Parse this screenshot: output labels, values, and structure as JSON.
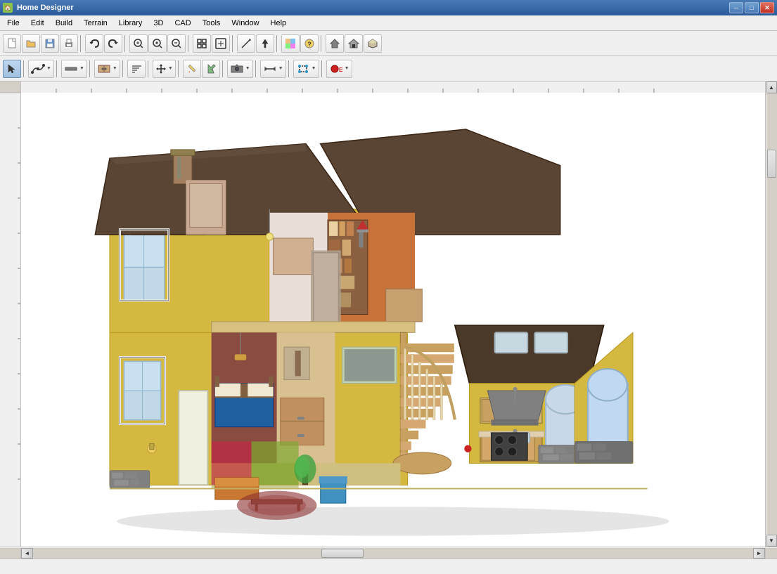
{
  "window": {
    "title": "Home Designer",
    "icon": "🏠"
  },
  "titlebar": {
    "controls": {
      "minimize": "─",
      "maximize": "□",
      "close": "✕"
    }
  },
  "menubar": {
    "items": [
      "File",
      "Edit",
      "Build",
      "Terrain",
      "Library",
      "3D",
      "CAD",
      "Tools",
      "Window",
      "Help"
    ]
  },
  "toolbar1": {
    "buttons": [
      {
        "id": "new",
        "icon": "📄",
        "title": "New"
      },
      {
        "id": "open",
        "icon": "📂",
        "title": "Open"
      },
      {
        "id": "save",
        "icon": "💾",
        "title": "Save"
      },
      {
        "id": "print",
        "icon": "🖨",
        "title": "Print"
      },
      {
        "id": "sep1",
        "type": "sep"
      },
      {
        "id": "undo",
        "icon": "↩",
        "title": "Undo"
      },
      {
        "id": "redo",
        "icon": "↪",
        "title": "Redo"
      },
      {
        "id": "sep2",
        "type": "sep"
      },
      {
        "id": "zoom-in-rect",
        "icon": "🔍",
        "title": "Zoom In"
      },
      {
        "id": "zoom-in",
        "icon": "⊕",
        "title": "Zoom In"
      },
      {
        "id": "zoom-out",
        "icon": "⊖",
        "title": "Zoom Out"
      },
      {
        "id": "sep3",
        "type": "sep"
      },
      {
        "id": "fit",
        "icon": "⊞",
        "title": "Fit"
      },
      {
        "id": "pan",
        "icon": "✋",
        "title": "Pan"
      },
      {
        "id": "sep4",
        "type": "sep"
      },
      {
        "id": "draw-line",
        "icon": "╱",
        "title": "Draw Line"
      },
      {
        "id": "arrow-up",
        "icon": "△",
        "title": "Arrow"
      },
      {
        "id": "sep5",
        "type": "sep"
      },
      {
        "id": "texture",
        "icon": "▣",
        "title": "Texture"
      },
      {
        "id": "help",
        "icon": "?",
        "title": "Help"
      },
      {
        "id": "sep6",
        "type": "sep"
      },
      {
        "id": "house1",
        "icon": "⌂",
        "title": "House"
      },
      {
        "id": "house2",
        "icon": "🏠",
        "title": "House 2"
      },
      {
        "id": "house3",
        "icon": "🏡",
        "title": "House 3"
      }
    ]
  },
  "toolbar2": {
    "buttons": [
      {
        "id": "select",
        "icon": "↖",
        "title": "Select",
        "active": true
      },
      {
        "id": "sep1",
        "type": "sep"
      },
      {
        "id": "polyline",
        "icon": "⌒",
        "title": "Polyline"
      },
      {
        "id": "sep2",
        "type": "sep"
      },
      {
        "id": "wall",
        "icon": "▬",
        "title": "Wall"
      },
      {
        "id": "sep3",
        "type": "sep"
      },
      {
        "id": "cabinet",
        "icon": "▦",
        "title": "Cabinet"
      },
      {
        "id": "sep4",
        "type": "sep"
      },
      {
        "id": "stairs",
        "icon": "⚏",
        "title": "Stairs"
      },
      {
        "id": "sep5",
        "type": "sep"
      },
      {
        "id": "move",
        "icon": "⊹",
        "title": "Move"
      },
      {
        "id": "sep6",
        "type": "sep"
      },
      {
        "id": "paint",
        "icon": "✏",
        "title": "Paint"
      },
      {
        "id": "material",
        "icon": "▨",
        "title": "Material"
      },
      {
        "id": "sep7",
        "type": "sep"
      },
      {
        "id": "camera",
        "icon": "📷",
        "title": "Camera"
      },
      {
        "id": "sep8",
        "type": "sep"
      },
      {
        "id": "arrow",
        "icon": "↑",
        "title": "Arrow"
      },
      {
        "id": "sep9",
        "type": "sep"
      },
      {
        "id": "transform",
        "icon": "⤡",
        "title": "Transform"
      },
      {
        "id": "sep10",
        "type": "sep"
      },
      {
        "id": "record",
        "icon": "⏺",
        "title": "Record",
        "color": "red"
      }
    ]
  },
  "statusbar": {
    "text": ""
  }
}
